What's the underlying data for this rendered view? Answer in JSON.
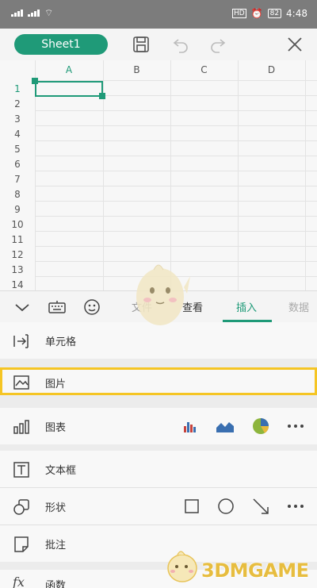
{
  "status_bar": {
    "hd": "HD",
    "battery": "82",
    "time": "4:48"
  },
  "toolbar": {
    "sheet_name": "Sheet1"
  },
  "grid": {
    "columns": [
      "A",
      "B",
      "C",
      "D"
    ],
    "rows": [
      "1",
      "2",
      "3",
      "4",
      "5",
      "6",
      "7",
      "8",
      "9",
      "10",
      "11",
      "12",
      "13",
      "14"
    ]
  },
  "ribbon": {
    "tabs": [
      "文件",
      "查看",
      "插入",
      "数据"
    ],
    "active_tab": "插入"
  },
  "insert_menu": {
    "items": [
      {
        "label": "单元格",
        "icon": "insert-cell-icon"
      },
      {
        "label": "图片",
        "icon": "picture-icon",
        "highlighted": true
      },
      {
        "label": "图表",
        "icon": "chart-icon",
        "options": [
          "bar-chart-icon",
          "area-chart-icon",
          "pie-chart-icon",
          "more-icon"
        ]
      },
      {
        "label": "文本框",
        "icon": "textbox-icon"
      },
      {
        "label": "形状",
        "icon": "shape-icon",
        "options": [
          "rectangle-icon",
          "circle-icon",
          "arrow-icon",
          "more-icon"
        ]
      },
      {
        "label": "批注",
        "icon": "comment-icon"
      },
      {
        "label": "函数",
        "icon": "function-icon"
      }
    ]
  },
  "watermark": {
    "text": "3DMGAME"
  },
  "colors": {
    "accent": "#1f9a78",
    "highlight": "#f5c524",
    "status_bar": "#7c7c7c"
  }
}
